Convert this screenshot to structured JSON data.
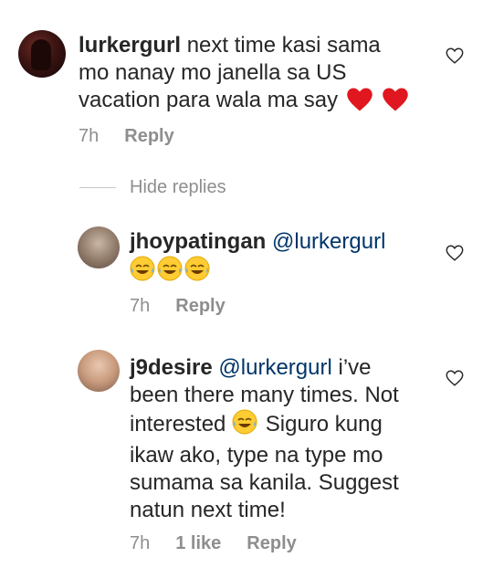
{
  "comments": [
    {
      "username": "lurkergurl",
      "lines": [
        "next time kasi sama",
        "mo nanay mo janella sa US",
        "vacation para wala ma say"
      ],
      "time": "7h",
      "reply_label": "Reply"
    },
    {
      "username": "jhoypatingan",
      "mention": "@lurkergurl",
      "time": "7h",
      "reply_label": "Reply"
    },
    {
      "username": "j9desire",
      "mention": "@lurkergurl",
      "lines": [
        "i’ve",
        "been there many times. Not",
        "interested",
        "Siguro kung",
        "ikaw ako, type na type mo",
        "sumama sa kanila. Suggest",
        "natun next time!"
      ],
      "time": "7h",
      "likes": "1 like",
      "reply_label": "Reply"
    }
  ],
  "hide_replies_label": "Hide replies",
  "icons": {
    "like": "heart-outline-icon",
    "red_heart": "red-heart-emoji",
    "laugh": "face-with-tears-of-joy-emoji"
  },
  "colors": {
    "text": "#262626",
    "muted": "#8e8e8e",
    "mention": "#003569",
    "red_heart": "#e0171f"
  }
}
